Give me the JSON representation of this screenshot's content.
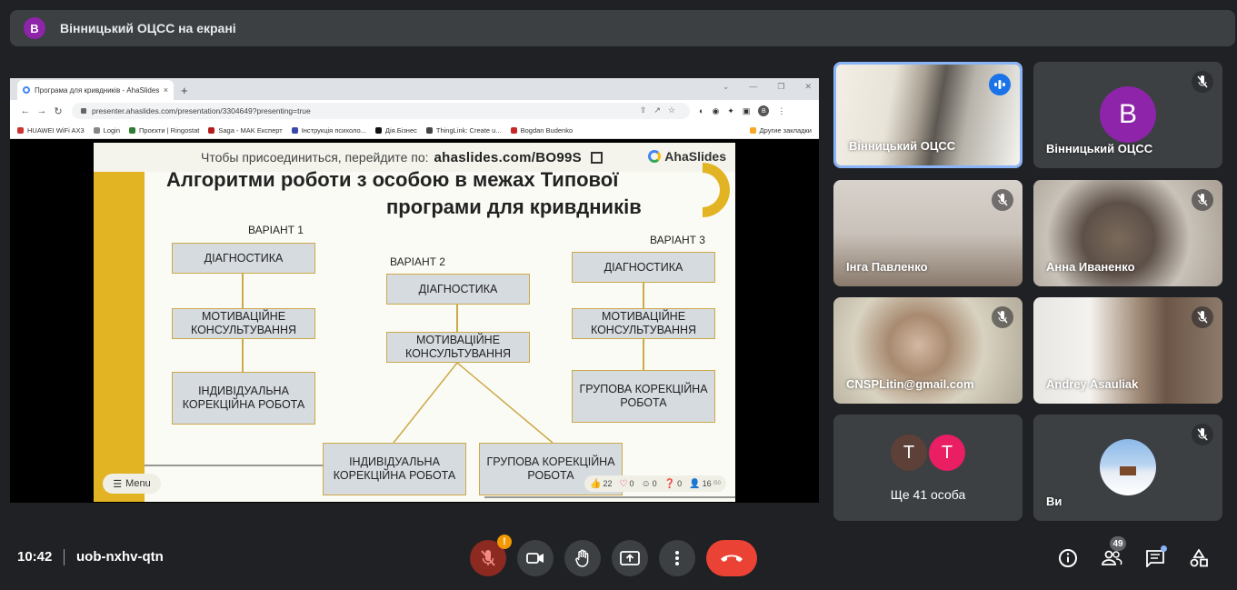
{
  "banner": {
    "avatar_letter": "В",
    "title": "Вінницький ОЦСС на екрані"
  },
  "browser": {
    "tab_title": "Програма для кривдників - AhaSlides",
    "tab_close": "×",
    "new_tab": "+",
    "url": "presenter.ahaslides.com/presentation/3304649?presenting=true",
    "profile_letter": "B",
    "bookmarks": [
      "HUAWEI WiFi AX3",
      "Login",
      "Проєкти | Ringostat",
      "Saga - MAK Експерт",
      "Інструкція психоло...",
      "Дія.Бізнес",
      "ThingLink: Create u...",
      "Bogdan Budenko"
    ],
    "other_bookmarks": "Другие закладки"
  },
  "slide": {
    "join_text": "Чтобы присоединиться, перейдите по:",
    "join_link": "ahaslides.com/BO99S",
    "brand": "AhaSlides",
    "title_line1": "Алгоритми роботи з особою в межах Типової",
    "title_line2": "програми для кривдників",
    "variant1": "ВАРІАНТ 1",
    "variant2": "ВАРІАНТ 2",
    "variant3": "ВАРІАНТ 3",
    "v1_box1": "ДІАГНОСТИКА",
    "v1_box2": "МОТИВАЦІЙНЕ КОНСУЛЬТУВАННЯ",
    "v1_box3": "ІНДИВІДУАЛЬНА КОРЕКЦІЙНА РОБОТА",
    "v2_box1": "ДІАГНОСТИКА",
    "v2_box2": "МОТИВАЦІЙНЕ КОНСУЛЬТУВАННЯ",
    "v2_box3": "ІНДИВІДУАЛЬНА КОРЕКЦІЙНА РОБОТА",
    "v2_box4": "ГРУПОВА КОРЕКЦІЙНА РОБОТА",
    "v3_box1": "ДІАГНОСТИКА",
    "v3_box2": "МОТИВАЦІЙНЕ КОНСУЛЬТУВАННЯ",
    "v3_box3": "ГРУПОВА КОРЕКЦІЙНА РОБОТА",
    "menu": "Menu",
    "reactions": {
      "likes": "22",
      "hearts": "0",
      "laughs": "0",
      "questions": "0",
      "audience": "16",
      "audience_suffix": "/50"
    }
  },
  "participants": [
    {
      "name": "Вінницький ОЦСС",
      "kind": "video",
      "speaking": true
    },
    {
      "name": "Вінницький ОЦСС",
      "kind": "avatar",
      "letter": "В",
      "muted": true
    },
    {
      "name": "Інга Павленко",
      "kind": "video",
      "muted": true
    },
    {
      "name": "Анна Иваненко",
      "kind": "video",
      "muted": true
    },
    {
      "name": "CNSPLitin@gmail.com",
      "kind": "video",
      "muted": true
    },
    {
      "name": "Andrey Asauliak",
      "kind": "video",
      "muted": true
    },
    {
      "name": "Ще 41 особа",
      "kind": "others",
      "letters": [
        "Т",
        "Т"
      ]
    },
    {
      "name": "Ви",
      "kind": "self",
      "muted": true
    }
  ],
  "colors": {
    "accent_purple": "#8e24aa",
    "other_brown": "#5d4037",
    "other_pink": "#e91e63",
    "hangup_red": "#ea4335",
    "speaking_blue": "#1a73e8",
    "slide_yellow": "#e2b323"
  },
  "footer": {
    "time": "10:42",
    "meeting_code": "uob-nxhv-qtn",
    "warning_badge": "!",
    "people_count": "49"
  }
}
